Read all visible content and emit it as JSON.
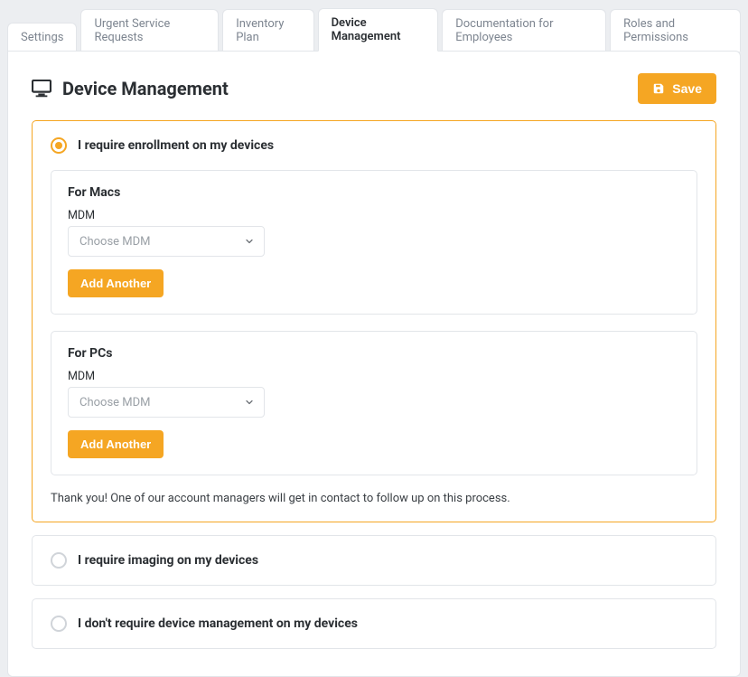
{
  "tabs": {
    "items": [
      {
        "label": "Settings"
      },
      {
        "label": "Urgent Service Requests"
      },
      {
        "label": "Inventory Plan"
      },
      {
        "label": "Device Management"
      },
      {
        "label": "Documentation for Employees"
      },
      {
        "label": "Roles and Permissions"
      }
    ],
    "active_index": 3
  },
  "header": {
    "title": "Device Management",
    "save_label": "Save"
  },
  "options": {
    "enroll": {
      "label": "I require enrollment on my devices",
      "selected": true,
      "macs": {
        "title": "For Macs",
        "field_label": "MDM",
        "placeholder": "Choose MDM",
        "add_another_label": "Add Another"
      },
      "pcs": {
        "title": "For PCs",
        "field_label": "MDM",
        "placeholder": "Choose MDM",
        "add_another_label": "Add Another"
      },
      "note": "Thank you! One of our account managers will get in contact to follow up on this process."
    },
    "imaging": {
      "label": "I require imaging on my devices",
      "selected": false
    },
    "none": {
      "label": "I don't require device management on my devices",
      "selected": false
    }
  }
}
